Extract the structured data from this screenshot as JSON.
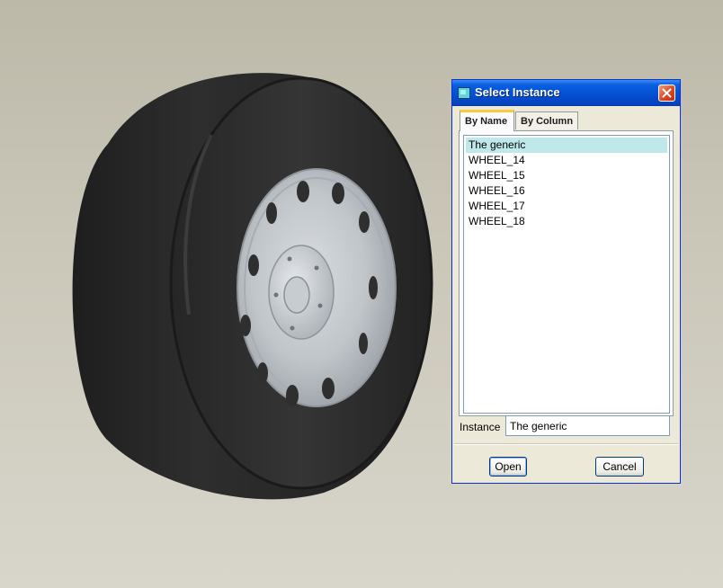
{
  "dialog": {
    "title": "Select Instance",
    "tabs": [
      {
        "label": "By Name",
        "active": true
      },
      {
        "label": "By Column",
        "active": false
      }
    ],
    "list_items": [
      "The generic",
      "WHEEL_14",
      "WHEEL_15",
      "WHEEL_16",
      "WHEEL_17",
      "WHEEL_18"
    ],
    "selected_item": "The generic",
    "instance_label": "Instance",
    "instance_value": "The generic",
    "open_label": "Open",
    "cancel_label": "Cancel"
  },
  "icons": {
    "title_icon": "window-app-icon",
    "close_icon": "close-x-icon"
  },
  "colors": {
    "titlebar": "#0452d6",
    "selection": "#bfe8ea",
    "close_button": "#d9431c",
    "tire": "#2a2a2a",
    "rim": "#bcc2c7"
  }
}
